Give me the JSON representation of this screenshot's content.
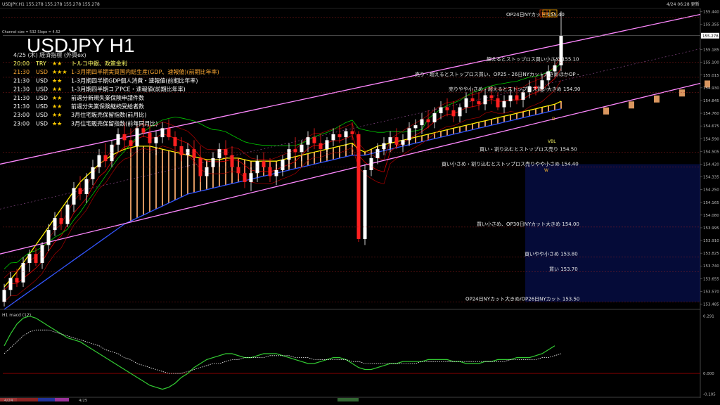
{
  "header": {
    "top_left": "USDJPY,H1  155.278 155.278 155.278 155.278",
    "top_right": "4/24 06:28 更新",
    "channel_info": "Channel size = 532 Slope = 4.52"
  },
  "chart_title": "USDJPY H1",
  "calendar": {
    "date_title": "4/25 (木) 経済指標 (外資ex)",
    "events": [
      {
        "time": "20:00",
        "cur": "TRY",
        "stars": "★★",
        "name": "トルコ中銀、政策金利",
        "color": "#ffff66"
      },
      {
        "time": "21:30",
        "cur": "USD",
        "stars": "★★★",
        "name": "1-3月期四半期実質国内総生産(GDP、速報値)(前期比年率)",
        "color": "#ffaa33"
      },
      {
        "time": "21:30",
        "cur": "USD",
        "stars": "★★",
        "name": "1-3月期四半期GDP個人消費・速報値(前期比年率)",
        "color": "#ffffff"
      },
      {
        "time": "21:30",
        "cur": "USD",
        "stars": "★★",
        "name": "1-3月期四半期コアPCE・速報値(前期比年率)",
        "color": "#ffffff"
      },
      {
        "time": "21:30",
        "cur": "USD",
        "stars": "★★",
        "name": "前週分新規失業保険申請件数",
        "color": "#ffffff"
      },
      {
        "time": "21:30",
        "cur": "USD",
        "stars": "★★",
        "name": "前週分失業保険継続受給者数",
        "color": "#ffffff"
      },
      {
        "time": "23:00",
        "cur": "USD",
        "stars": "★★",
        "name": "3月住宅販売保留指数(前月比)",
        "color": "#ffffff"
      },
      {
        "time": "23:00",
        "cur": "USD",
        "stars": "★★",
        "name": "3月住宅販売保留指数(前年同月比)",
        "color": "#ffffff"
      }
    ]
  },
  "levels": [
    {
      "label": "OP24日NYカット 155.40",
      "price": 155.4
    },
    {
      "label": "超えるとストップロス買い小さめ 155.10",
      "price": 155.1
    },
    {
      "label": "売り・超えるとストップロス買い、OP25・26日NYカット大きめほかOP・",
      "price": 155.0
    },
    {
      "label": "売りやや小さめ・超えるとストップロス買い大きめ 154.90",
      "price": 154.9
    },
    {
      "label": "買い・割り込むとストップロス売り 154.50",
      "price": 154.5
    },
    {
      "label": "買い小さめ・割り込むとストップロス売りやや小さめ 154.40",
      "price": 154.4
    },
    {
      "label": "買い小さめ、OP30日NYカット大きめ 154.00",
      "price": 154.0
    },
    {
      "label": "買いやや小さめ 153.80",
      "price": 153.8
    },
    {
      "label": "買い 153.70",
      "price": 153.7
    },
    {
      "label": "OP24日NYカット大きめ/OP26日NYカット 153.50",
      "price": 153.5
    }
  ],
  "markers": {
    "high_marker": "H",
    "wd_marker": "W",
    "d_marker": "D",
    "vbl": "VBL",
    "w": "W",
    "d": "D"
  },
  "colors": {
    "background": "#000000",
    "up": "#ffffff",
    "down": "#ff2020",
    "channel": "#ff88ff",
    "grid": "#2a2a2a",
    "ma_yellow": "#ffee00",
    "ma_blue": "#3355ff",
    "ma_green": "#00cc00",
    "ma_red": "#cc0000",
    "cloud": "#ffb070"
  },
  "chart_data": [
    {
      "type": "line",
      "title": "",
      "subtitle": "",
      "xlabel": "",
      "ylabel": "",
      "ylim": [
        153.45,
        155.46
      ],
      "y_ticks": [
        155.44,
        155.355,
        155.27,
        155.185,
        155.1,
        155.015,
        154.93,
        154.845,
        154.76,
        154.675,
        154.59,
        154.505,
        154.42,
        154.335,
        154.25,
        154.165,
        154.08,
        153.995,
        153.91,
        153.825,
        153.74,
        153.655,
        153.57,
        153.485
      ],
      "x_labels": [
        "4/24",
        "4/25"
      ],
      "legend": "none",
      "grid": false,
      "last_price": 155.278,
      "candles": [
        [
          153.5,
          153.62,
          153.47,
          153.58
        ],
        [
          153.58,
          153.7,
          153.54,
          153.66
        ],
        [
          153.66,
          153.72,
          153.6,
          153.63
        ],
        [
          153.63,
          153.8,
          153.6,
          153.76
        ],
        [
          153.76,
          153.85,
          153.7,
          153.82
        ],
        [
          153.82,
          153.86,
          153.74,
          153.76
        ],
        [
          153.76,
          153.9,
          153.72,
          153.88
        ],
        [
          153.88,
          154.02,
          153.84,
          153.98
        ],
        [
          153.98,
          154.1,
          153.94,
          154.06
        ],
        [
          154.06,
          154.12,
          153.98,
          154.02
        ],
        [
          154.02,
          154.18,
          154.0,
          154.15
        ],
        [
          154.15,
          154.3,
          154.1,
          154.26
        ],
        [
          154.26,
          154.34,
          154.18,
          154.22
        ],
        [
          154.22,
          154.36,
          154.16,
          154.32
        ],
        [
          154.32,
          154.45,
          154.28,
          154.4
        ],
        [
          154.4,
          154.52,
          154.36,
          154.48
        ],
        [
          154.48,
          154.56,
          154.4,
          154.44
        ],
        [
          154.44,
          154.58,
          154.4,
          154.55
        ],
        [
          154.55,
          154.66,
          154.5,
          154.62
        ],
        [
          154.62,
          154.7,
          154.52,
          154.58
        ],
        [
          154.58,
          154.66,
          154.5,
          154.54
        ],
        [
          154.54,
          154.7,
          154.5,
          154.66
        ],
        [
          154.66,
          154.72,
          154.6,
          154.63
        ],
        [
          154.63,
          154.68,
          154.52,
          154.56
        ],
        [
          154.56,
          154.64,
          154.48,
          154.6
        ],
        [
          154.6,
          154.7,
          154.56,
          154.66
        ],
        [
          154.66,
          154.72,
          154.58,
          154.6
        ],
        [
          154.6,
          154.64,
          154.5,
          154.54
        ],
        [
          154.54,
          154.6,
          154.44,
          154.48
        ],
        [
          154.48,
          154.56,
          154.4,
          154.52
        ],
        [
          154.52,
          154.58,
          154.42,
          154.46
        ],
        [
          154.46,
          154.54,
          154.3,
          154.34
        ],
        [
          154.34,
          154.44,
          154.26,
          154.4
        ],
        [
          154.4,
          154.5,
          154.36,
          154.46
        ],
        [
          154.46,
          154.56,
          154.4,
          154.52
        ],
        [
          154.52,
          154.58,
          154.44,
          154.48
        ],
        [
          154.48,
          154.54,
          154.36,
          154.4
        ],
        [
          154.4,
          154.46,
          154.32,
          154.36
        ],
        [
          154.36,
          154.42,
          154.26,
          154.3
        ],
        [
          154.3,
          154.4,
          154.24,
          154.36
        ],
        [
          154.36,
          154.48,
          154.3,
          154.44
        ],
        [
          154.44,
          154.5,
          154.36,
          154.4
        ],
        [
          154.4,
          154.46,
          154.3,
          154.34
        ],
        [
          154.34,
          154.42,
          154.28,
          154.38
        ],
        [
          154.38,
          154.48,
          154.34,
          154.45
        ],
        [
          154.45,
          154.56,
          154.4,
          154.52
        ],
        [
          154.52,
          154.6,
          154.46,
          154.5
        ],
        [
          154.5,
          154.58,
          154.44,
          154.55
        ],
        [
          154.55,
          154.64,
          154.5,
          154.6
        ],
        [
          154.6,
          154.66,
          154.52,
          154.56
        ],
        [
          154.56,
          154.62,
          154.48,
          154.52
        ],
        [
          154.52,
          154.6,
          154.46,
          154.58
        ],
        [
          154.58,
          154.66,
          154.54,
          154.62
        ],
        [
          154.62,
          154.68,
          154.56,
          154.6
        ],
        [
          154.6,
          154.66,
          154.54,
          154.64
        ],
        [
          154.64,
          154.7,
          154.58,
          154.62
        ],
        [
          154.62,
          154.64,
          153.9,
          153.92
        ],
        [
          153.92,
          154.42,
          153.88,
          154.38
        ],
        [
          154.38,
          154.5,
          154.34,
          154.46
        ],
        [
          154.46,
          154.56,
          154.42,
          154.52
        ],
        [
          154.52,
          154.6,
          154.48,
          154.56
        ],
        [
          154.56,
          154.64,
          154.5,
          154.6
        ],
        [
          154.6,
          154.66,
          154.52,
          154.55
        ],
        [
          154.55,
          154.62,
          154.5,
          154.58
        ],
        [
          154.58,
          154.7,
          154.54,
          154.66
        ],
        [
          154.66,
          154.72,
          154.6,
          154.68
        ],
        [
          154.68,
          154.76,
          154.62,
          154.72
        ],
        [
          154.72,
          154.78,
          154.66,
          154.7
        ],
        [
          154.7,
          154.8,
          154.66,
          154.76
        ],
        [
          154.76,
          154.84,
          154.72,
          154.8
        ],
        [
          154.8,
          154.86,
          154.74,
          154.78
        ],
        [
          154.78,
          154.84,
          154.7,
          154.74
        ],
        [
          154.74,
          154.82,
          154.7,
          154.8
        ],
        [
          154.8,
          154.9,
          154.76,
          154.86
        ],
        [
          154.86,
          154.92,
          154.8,
          154.84
        ],
        [
          154.84,
          154.9,
          154.78,
          154.82
        ],
        [
          154.82,
          154.92,
          154.78,
          154.88
        ],
        [
          154.88,
          154.94,
          154.82,
          154.86
        ],
        [
          154.86,
          154.9,
          154.78,
          154.8
        ],
        [
          154.8,
          154.88,
          154.76,
          154.84
        ],
        [
          154.84,
          154.92,
          154.8,
          154.88
        ],
        [
          154.88,
          154.94,
          154.82,
          154.85
        ],
        [
          154.85,
          154.92,
          154.8,
          154.9
        ],
        [
          154.9,
          154.98,
          154.86,
          154.94
        ],
        [
          154.94,
          155.0,
          154.88,
          154.92
        ],
        [
          154.92,
          155.02,
          154.9,
          154.98
        ],
        [
          154.98,
          155.08,
          154.94,
          155.04
        ],
        [
          155.04,
          155.12,
          155.0,
          155.08
        ],
        [
          155.08,
          155.44,
          155.04,
          155.278
        ]
      ],
      "cloud_span": {
        "start_index": 20,
        "end_index": 110
      },
      "projected_steps": [
        [
          88,
          154.78
        ],
        [
          92,
          154.82
        ],
        [
          96,
          154.86
        ],
        [
          100,
          154.9
        ],
        [
          104,
          154.96
        ],
        [
          108,
          155.04
        ],
        [
          110,
          155.1
        ]
      ],
      "channel": {
        "upper_start": 154.42,
        "upper_end": 155.42,
        "lower_start": 153.82,
        "lower_end": 154.96
      },
      "series": [
        {
          "values": [
            153.6,
            153.65,
            153.7,
            153.76,
            153.82,
            153.88,
            153.94,
            154.0,
            154.06,
            154.12,
            154.18,
            154.24,
            154.3,
            154.34,
            154.38,
            154.42,
            154.45,
            154.48,
            154.5,
            154.52,
            154.53,
            154.54,
            154.54,
            154.54,
            154.53,
            154.52,
            154.51,
            154.5,
            154.49,
            154.48,
            154.47,
            154.46,
            154.45,
            154.45,
            154.45,
            154.46,
            154.46,
            154.46,
            154.45,
            154.44,
            154.44,
            154.44,
            154.44,
            154.44,
            154.45,
            154.46,
            154.47,
            154.48,
            154.49,
            154.5,
            154.51,
            154.52,
            154.53,
            154.54,
            154.55,
            154.56,
            154.52,
            154.5,
            154.52,
            154.54,
            154.55,
            154.56,
            154.57,
            154.58,
            154.59,
            154.6,
            154.61,
            154.62,
            154.63,
            154.64,
            154.65,
            154.66,
            154.67,
            154.68,
            154.69,
            154.7,
            154.71,
            154.72,
            154.73,
            154.74,
            154.75,
            154.76,
            154.77,
            154.78,
            154.79,
            154.8,
            154.81,
            154.82,
            154.84
          ]
        },
        {
          "values": [
            153.45,
            153.48,
            153.51,
            153.54,
            153.57,
            153.6,
            153.63,
            153.66,
            153.69,
            153.72,
            153.75,
            153.78,
            153.81,
            153.84,
            153.87,
            153.9,
            153.93,
            153.96,
            153.99,
            154.02,
            154.04,
            154.06,
            154.08,
            154.1,
            154.12,
            154.14,
            154.16,
            154.18,
            154.2,
            154.22,
            154.23,
            154.24,
            154.25,
            154.26,
            154.27,
            154.28,
            154.29,
            154.3,
            154.31,
            154.32,
            154.33,
            154.34,
            154.35,
            154.36,
            154.37,
            154.38,
            154.39,
            154.4,
            154.41,
            154.42,
            154.43,
            154.44,
            154.45,
            154.46,
            154.47,
            154.48,
            154.48,
            154.48,
            154.49,
            154.5,
            154.51,
            154.52,
            154.53,
            154.54,
            154.55,
            154.56,
            154.57,
            154.58,
            154.59,
            154.6,
            154.61,
            154.62,
            154.63,
            154.64,
            154.65,
            154.66,
            154.67,
            154.68,
            154.69,
            154.7,
            154.71,
            154.72,
            154.73,
            154.74,
            154.75,
            154.76,
            154.77,
            154.78,
            154.79
          ]
        }
      ]
    },
    {
      "type": "line",
      "title": "H1  macd (12)",
      "ylim": [
        -0.11,
        0.31
      ],
      "y_ticks": [
        0.291,
        0.0,
        -0.105
      ],
      "series": [
        {
          "values": [
            0.14,
            0.2,
            0.25,
            0.28,
            0.29,
            0.28,
            0.26,
            0.24,
            0.22,
            0.2,
            0.18,
            0.17,
            0.16,
            0.14,
            0.12,
            0.1,
            0.08,
            0.06,
            0.04,
            0.02,
            0.0,
            -0.02,
            -0.04,
            -0.06,
            -0.07,
            -0.08,
            -0.07,
            -0.05,
            -0.02,
            0.0,
            0.03,
            0.05,
            0.07,
            0.08,
            0.09,
            0.1,
            0.1,
            0.09,
            0.08,
            0.08,
            0.09,
            0.1,
            0.1,
            0.1,
            0.09,
            0.08,
            0.07,
            0.06,
            0.05,
            0.05,
            0.06,
            0.07,
            0.08,
            0.08,
            0.07,
            0.05,
            0.03,
            0.02,
            0.02,
            0.03,
            0.04,
            0.05,
            0.05,
            0.06,
            0.06,
            0.06,
            0.06,
            0.07,
            0.07,
            0.07,
            0.07,
            0.06,
            0.06,
            0.05,
            0.05,
            0.05,
            0.06,
            0.06,
            0.07,
            0.07,
            0.07,
            0.08,
            0.08,
            0.08,
            0.09,
            0.1,
            0.12,
            0.14
          ]
        },
        {
          "values": [
            0.1,
            0.13,
            0.16,
            0.19,
            0.21,
            0.22,
            0.22,
            0.22,
            0.21,
            0.2,
            0.19,
            0.18,
            0.17,
            0.16,
            0.15,
            0.14,
            0.12,
            0.11,
            0.1,
            0.08,
            0.07,
            0.05,
            0.04,
            0.03,
            0.02,
            0.01,
            0.0,
            0.0,
            0.0,
            0.01,
            0.02,
            0.03,
            0.04,
            0.05,
            0.05,
            0.06,
            0.07,
            0.07,
            0.08,
            0.08,
            0.08,
            0.08,
            0.09,
            0.09,
            0.09,
            0.09,
            0.08,
            0.08,
            0.08,
            0.07,
            0.07,
            0.07,
            0.07,
            0.07,
            0.07,
            0.06,
            0.06,
            0.05,
            0.05,
            0.05,
            0.05,
            0.05,
            0.05,
            0.05,
            0.05,
            0.05,
            0.06,
            0.06,
            0.06,
            0.06,
            0.06,
            0.06,
            0.06,
            0.06,
            0.06,
            0.06,
            0.06,
            0.06,
            0.06,
            0.06,
            0.07,
            0.07,
            0.07,
            0.07,
            0.07,
            0.08,
            0.08,
            0.09,
            0.1
          ]
        }
      ]
    }
  ]
}
